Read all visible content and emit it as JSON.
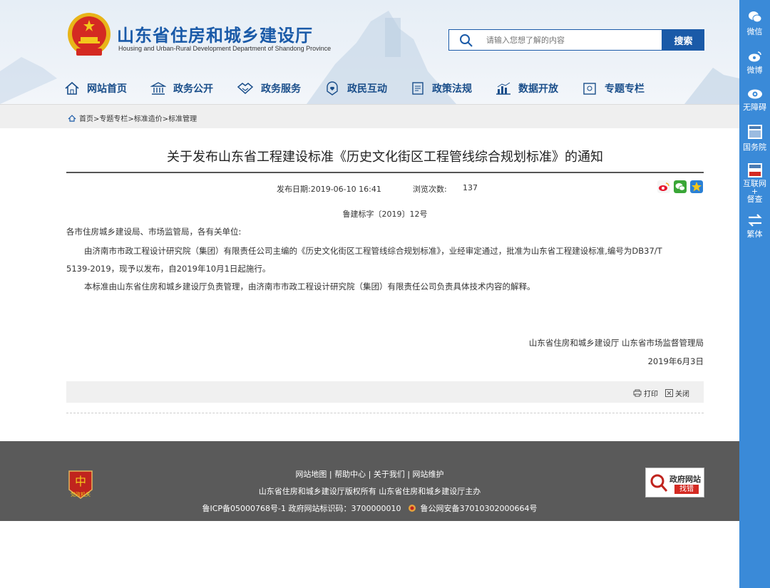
{
  "header": {
    "title": "山东省住房和城乡建设厅",
    "subtitle": "Housing and Urban-Rural Development Department of Shandong Province",
    "search_placeholder": "请输入您想了解的内容",
    "search_button": "搜索"
  },
  "nav": [
    {
      "label": "网站首页",
      "icon": "home-icon"
    },
    {
      "label": "政务公开",
      "icon": "government-building-icon"
    },
    {
      "label": "政务服务",
      "icon": "handshake-icon"
    },
    {
      "label": "政民互动",
      "icon": "people-heart-icon"
    },
    {
      "label": "政策法规",
      "icon": "document-icon"
    },
    {
      "label": "数据开放",
      "icon": "bar-chart-icon"
    },
    {
      "label": "专题专栏",
      "icon": "folder-icon"
    }
  ],
  "breadcrumb": "首页>专题专栏>标准造价>标准管理",
  "sidebar": [
    {
      "label": "微信",
      "icon": "wechat-icon"
    },
    {
      "label": "微博",
      "icon": "weibo-icon"
    },
    {
      "label": "无障碍",
      "icon": "eye-icon"
    },
    {
      "label": "国务院",
      "icon": "state-council-icon"
    },
    {
      "label": "互联网",
      "label2": "+",
      "label3": "督查",
      "icon": "internet-inspection-icon"
    },
    {
      "label": "繁体",
      "icon": "switch-arrows-icon"
    }
  ],
  "article": {
    "title": "关于发布山东省工程建设标准《历史文化街区工程管线综合规划标准》的通知",
    "publish_date": "发布日期:2019-06-10 16:41",
    "views_label": "浏览次数:",
    "views": "137",
    "doc_number": "鲁建标字〔2019〕12号",
    "salutation": "各市住房城乡建设局、市场监管局，各有关单位:",
    "para1_line1": "由济南市市政工程设计研究院（集团）有限责任公司主编的《历史文化街区工程管线综合规划标准》，业经审定通过，批准为山东省工程建设标准,编号为DB37/T",
    "para1_line2": "5139-2019，现予以发布，自2019年10月1日起施行。",
    "para2": "本标准由山东省住房和城乡建设厅负责管理，由济南市市政工程设计研究院（集团）有限责任公司负责具体技术内容的解释。",
    "signature": "山东省住房和城乡建设厅   山东省市场监督管理局",
    "sign_date": "2019年6月3日",
    "print_label": "打印",
    "close_label": "关闭"
  },
  "footer": {
    "links": "网站地图 | 帮助中心 | 关于我们 | 网站维护",
    "copyright": "山东省住房和城乡建设厅版权所有 山东省住房和城乡建设厅主办",
    "icp": "鲁ICP备05000768号-1 政府网站标识码：3700000010",
    "police": "鲁公网安备37010302000664号",
    "badge_label": "党政机关",
    "jiucuo_title": "政府网站",
    "jiucuo_sub": "找错"
  },
  "colors": {
    "brand_blue": "#1a5aa8",
    "sidebar_blue": "#3a8ad8",
    "footer_gray": "#5a5a5a"
  }
}
